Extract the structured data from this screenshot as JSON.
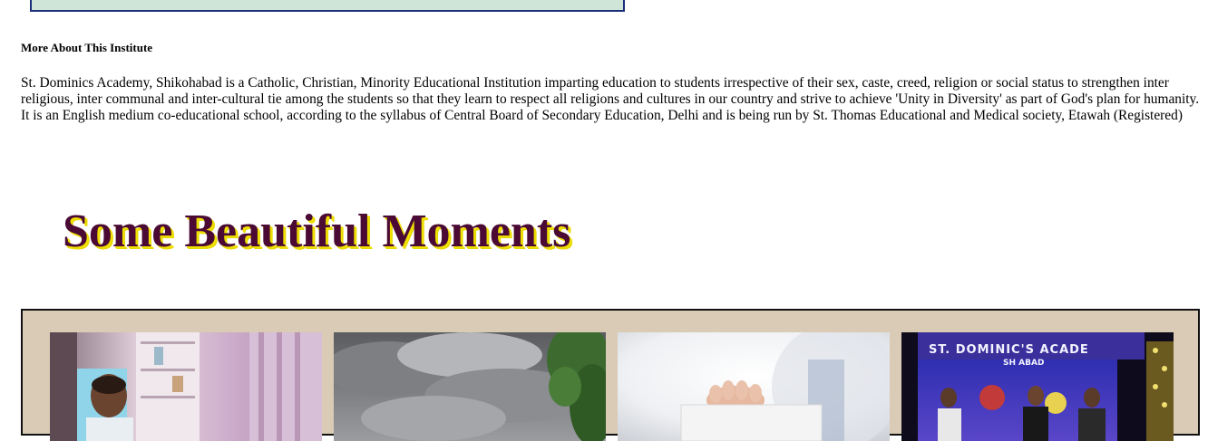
{
  "about": {
    "heading": "More About This Institute",
    "text": "St. Dominics Academy, Shikohabad is a Catholic, Christian, Minority Educational Institution imparting education to students irrespective of their sex, caste, creed, religion or social status to strengthen inter religious, inter communal and inter-cultural tie among the students so that they learn to respect all religions and cultures in our country and strive to achieve 'Unity in Diversity' as part of God's plan for humanity. It is an English medium co-educational school, according to the syllabus of Central Board of Secondary Education, Delhi and is being run by St. Thomas Educational and Medical society, Etawah (Registered)"
  },
  "moments": {
    "title": "Some Beautiful Moments"
  },
  "gallery": {
    "items": [
      {
        "photo": "principal-office-photo"
      },
      {
        "photo": "cloudy-sky-photo"
      },
      {
        "photo": "hand-holding-card-photo"
      },
      {
        "photo": "stage-event-photo",
        "banner": "ST. DOMINIC'S ACADE",
        "banner_sub": "SH   ABAD"
      }
    ]
  },
  "colors": {
    "title": "#4a0a34",
    "title_shadow": "#f0e000",
    "gallery_bg": "#d9cbb5",
    "top_box_bg": "#cfe5d8",
    "top_box_border": "#1a2f7a"
  }
}
